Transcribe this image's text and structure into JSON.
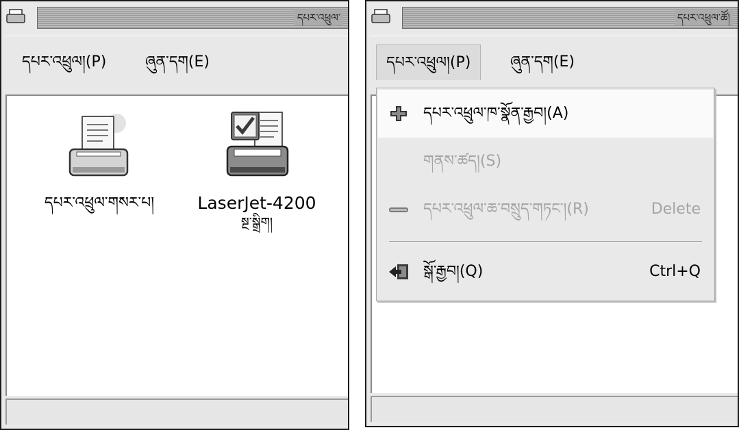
{
  "left_window": {
    "title": "དཔར་འཕྲུལ་",
    "menubar": {
      "printer_menu": "དཔར་འཕྲུལ།(P)",
      "edit_menu": "ཞུན་དག(E)"
    },
    "printers": [
      {
        "label": "དཔར་འཕྲུལ་གསར་པ།",
        "sublabel": "",
        "icon": "printer-add-icon"
      },
      {
        "label": "LaserJet-4200",
        "sublabel": "སྔ་སྒྲིག།",
        "icon": "printer-default-icon"
      }
    ]
  },
  "right_window": {
    "title": "དཔར་འཕྲུལ་ཚོ།",
    "menubar": {
      "printer_menu": "དཔར་འཕྲུལ།(P)",
      "edit_menu": "ཞུན་དག(E)"
    },
    "dropdown": {
      "add": {
        "label": "དཔར་འཕྲུལ་ཁ་སྣོན་རྒྱབ།(A)",
        "icon": "plus-icon"
      },
      "properties": {
        "label": "གནས་ཚད།(S)"
      },
      "remove": {
        "label": "དཔར་འཕྲུལ་ཆ་བསྲུད་གཏང་།(R)",
        "accel": "Delete",
        "icon": "minus-icon"
      },
      "quit": {
        "label": "སྒོ་རྒྱབ།(Q)",
        "accel": "Ctrl+Q",
        "icon": "exit-icon"
      }
    }
  }
}
